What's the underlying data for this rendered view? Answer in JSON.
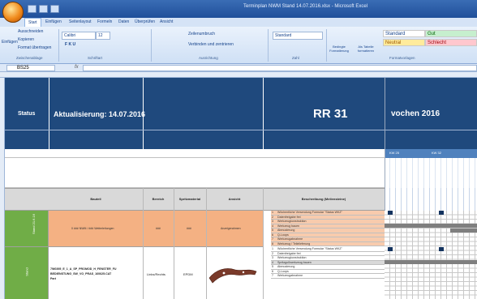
{
  "window": {
    "title": "Terminplan NWM Stand 14.07.2016.xlsx - Microsoft Excel"
  },
  "ribbon_tabs": [
    "Start",
    "Einfügen",
    "Seitenlayout",
    "Formeln",
    "Daten",
    "Überprüfen",
    "Ansicht"
  ],
  "clipboard": {
    "paste": "Einfügen",
    "cut": "Ausschneiden",
    "copy": "Kopieren",
    "format_painter": "Format übertragen",
    "group": "Zwischenablage"
  },
  "font": {
    "name": "Calibri",
    "size": "12",
    "group": "Schriftart"
  },
  "alignment": {
    "wrap": "Zeilenumbruch",
    "merge": "Verbinden und zentrieren",
    "group": "Ausrichtung"
  },
  "number": {
    "format": "Standard",
    "group": "Zahl"
  },
  "styles": {
    "cond_format": "Bedingte Formatierung",
    "as_table": "Als Tabelle formatieren",
    "group": "Formatvorlagen",
    "cells": [
      "Standard",
      "Gut",
      "Neutral",
      "Schlecht"
    ],
    "colors": {
      "standard": "#ffffff",
      "gut": "#c6efce",
      "neutral": "#ffeb9c",
      "schlecht": "#ffc7ce",
      "gut_text": "#006100",
      "neutral_text": "#9c5700",
      "schlecht_text": "#9c0006"
    }
  },
  "name_box": "BS25",
  "fx": "fx",
  "sheet": {
    "status_label": "Status",
    "update_label": "Aktualisierung: 14.07.2016",
    "project_title": "RR 31",
    "weeks_label": "vochen 2016",
    "kw_labels": [
      "KW 25",
      "KW 32"
    ],
    "columns": [
      "Bauteil",
      "Bereich",
      "Spritzmaterial",
      "Ansicht",
      "Beschreibung (Meilensteine)"
    ],
    "row1": {
      "status": "Stand 21.6.16",
      "bauteil": "0 ### NWM / ### Weiterleitungen",
      "bereich": "###",
      "material": "###",
      "ansicht": "Anzeigerahmen"
    },
    "row2": {
      "status": "Stand",
      "bauteil": [
        "7W0395_E_1_A_SP_PROMOD_H_FENSTER_FU",
        "BEDIENSTUNG_SW_VO_PRAS_160625.CAT",
        "Part"
      ],
      "bereich": "Links/Rechts",
      "material": "EPDM"
    },
    "steps1": [
      {
        "n": "1",
        "t": "Wöchentliche Versendung Formular \"Status WKZ\""
      },
      {
        "n": "2",
        "t": "Datenfreigabe frei"
      },
      {
        "n": "3",
        "t": "Werkzeugkonstruktion"
      },
      {
        "n": "4",
        "t": "Werkzeug bauen"
      },
      {
        "n": "5",
        "t": "Abmusterung"
      },
      {
        "n": "6",
        "t": "Q-Loops"
      },
      {
        "n": "7",
        "t": "Werkzeugabnahme"
      },
      {
        "n": "8",
        "t": "Werkzeug / Teilelieferung"
      }
    ],
    "steps2": [
      {
        "n": "1",
        "t": "Wöchentliche Versendung Formular \"Status WKZ\""
      },
      {
        "n": "2",
        "t": "Datenfreigabe frei"
      },
      {
        "n": "3",
        "t": "Werkzeugkonstruktion"
      },
      {
        "n": "4",
        "t": "Spritzgußwerkzeug bauen"
      },
      {
        "n": "5",
        "t": "Abmusterung"
      },
      {
        "n": "6",
        "t": "Q-Loops"
      },
      {
        "n": "7",
        "t": "Werkzeugabnahme"
      }
    ]
  }
}
